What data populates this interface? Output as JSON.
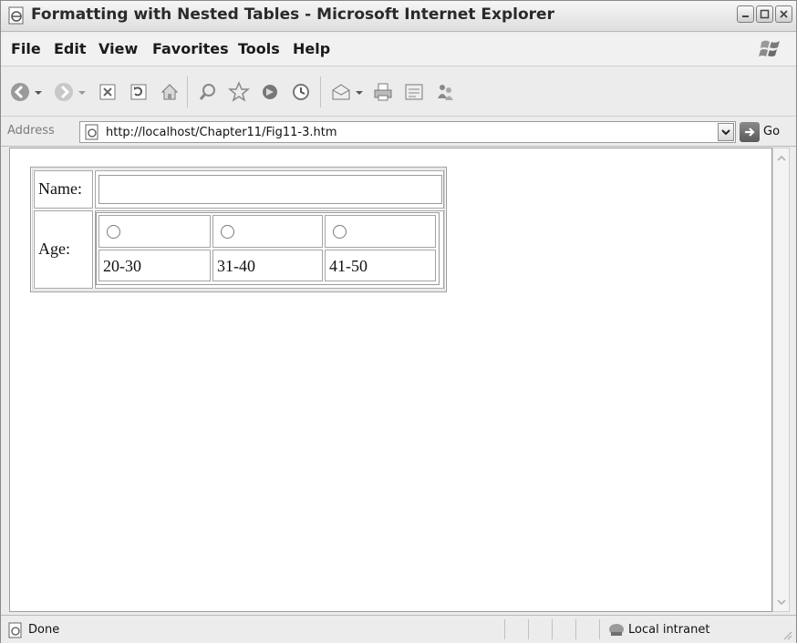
{
  "window": {
    "title": "Formatting with Nested Tables - Microsoft Internet Explorer"
  },
  "menu": {
    "items": [
      "File",
      "Edit",
      "View",
      "Favorites",
      "Tools",
      "Help"
    ]
  },
  "toolbar": {
    "icons": [
      "back-icon",
      "forward-icon",
      "stop-icon",
      "refresh-icon",
      "home-icon",
      "search-icon",
      "favorites-icon",
      "media-icon",
      "history-icon",
      "mail-icon",
      "print-icon",
      "edit-icon",
      "messenger-icon"
    ]
  },
  "address": {
    "label": "Address",
    "url": "http://localhost/Chapter11/Fig11-3.htm",
    "go_label": "Go"
  },
  "page": {
    "name_label": "Name:",
    "name_value": "",
    "age_label": "Age:",
    "age_options": [
      "20-30",
      "31-40",
      "41-50"
    ]
  },
  "status": {
    "text": "Done",
    "zone": "Local intranet"
  },
  "colors": {
    "chrome": "#ececec",
    "page_background": "#ffffff",
    "border": "#9a9a9a"
  }
}
